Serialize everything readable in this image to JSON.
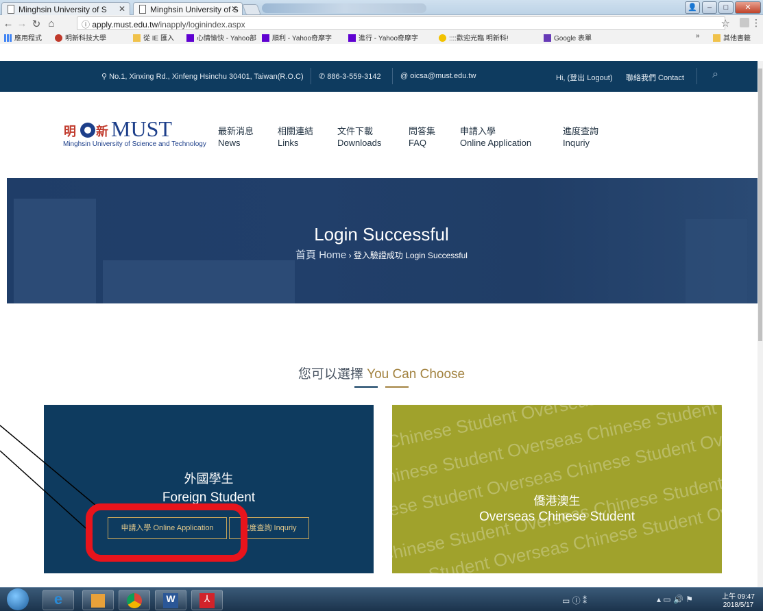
{
  "browser": {
    "tabs": [
      "Minghsin University of S",
      "Minghsin University of S"
    ],
    "url_host": "apply.must.edu.tw",
    "url_path": "/inapply/loginindex.aspx",
    "bookmarks": [
      "應用程式",
      "明新科技大學",
      "從 IE 匯入",
      "心情愉快 - Yahoo部",
      "順利 - Yahoo奇摩字",
      "進行 - Yahoo奇摩字",
      "::::歡迎光臨 明新科!",
      "Google 表單"
    ],
    "other_bookmarks": "其他書籤",
    "more": "»"
  },
  "topbar": {
    "address": "No.1, Xinxing Rd., Xinfeng Hsinchu 30401, Taiwan(R.O.C)",
    "phone": "886-3-559-3142",
    "email": "oicsa@must.edu.tw",
    "logout": "Hi, (登出 Logout)",
    "contact": "聯絡我們 Contact"
  },
  "header": {
    "logo_cn": "明新",
    "logo_name": "MUST",
    "logo_sub": "Minghsin University of Science and Technology",
    "menu": [
      {
        "cn": "最新消息",
        "en": "News"
      },
      {
        "cn": "相關連結",
        "en": "Links"
      },
      {
        "cn": "文件下載",
        "en": "Downloads"
      },
      {
        "cn": "問答集",
        "en": "FAQ"
      },
      {
        "cn": "申請入學",
        "en": "Online Application"
      },
      {
        "cn": "進度查詢",
        "en": "Inquriy"
      }
    ]
  },
  "hero": {
    "title": "Login Successful",
    "crumb_home": "首頁 Home",
    "crumb_sep": "›",
    "crumb_current": "登入驗證成功 Login Successful"
  },
  "choose": {
    "cn": "您可以選擇",
    "en": "You Can Choose"
  },
  "cards": {
    "foreign": {
      "cn": "外國學生",
      "en": "Foreign Student",
      "apply": "申請入學 Online Application",
      "inquiry": "進度查詢 Inquriy"
    },
    "overseas": {
      "cn": "僑港澳生",
      "en": "Overseas Chinese Student",
      "watermark": "Chinese Student Overseas Chinese Student Overseas"
    }
  },
  "taskbar": {
    "time": "上午 09:47",
    "date": "2018/5/17"
  },
  "colors": {
    "navy": "#0e3b5f",
    "gold": "#a2823f",
    "olive": "#a0a22c",
    "annotation_red": "#e8141c"
  }
}
